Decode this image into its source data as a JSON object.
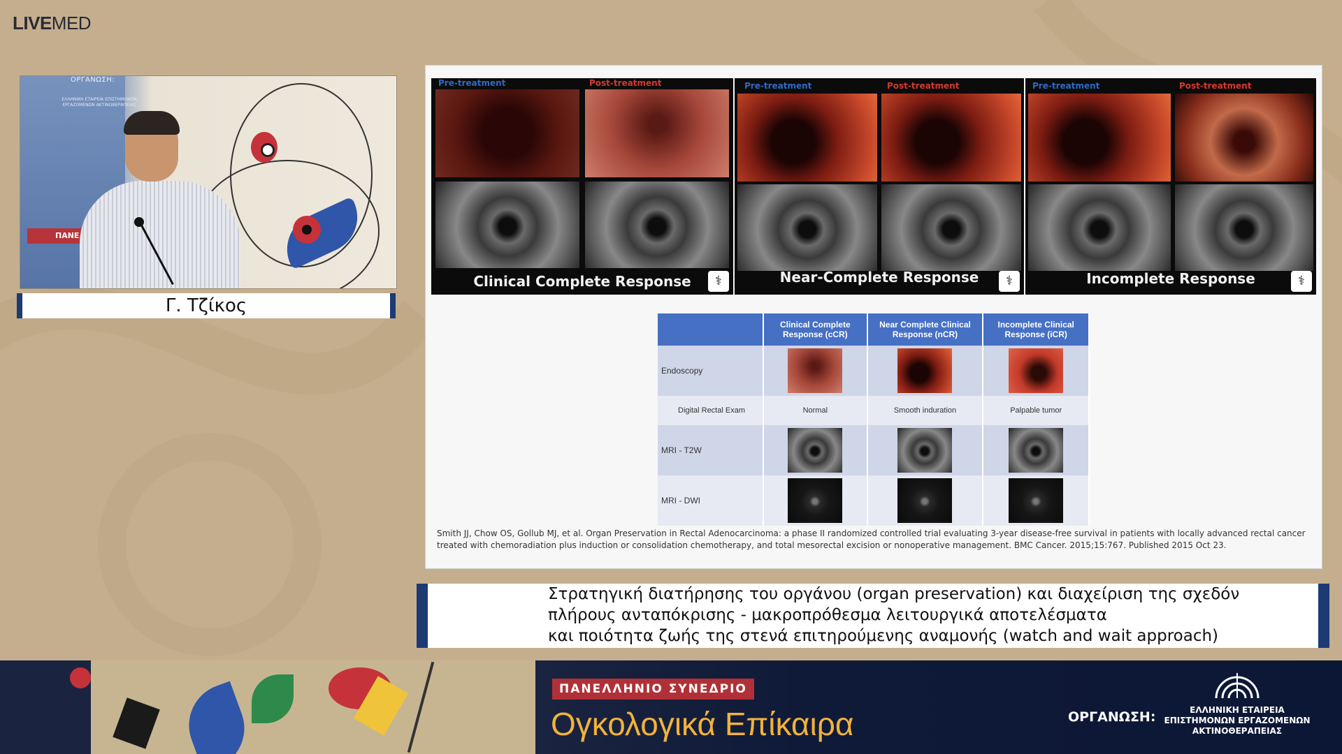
{
  "brand": {
    "logo_bold": "LIVE",
    "logo_rest": "MED"
  },
  "speaker": {
    "name": "Γ. Τζίκος",
    "backdrop_label": "ΟΡΓΑΝΩΣΗ:",
    "backdrop_small": "ΕΛΛΗΝΙΚΗ ΕΤΑΙΡΕΙΑ ΕΠΙΣΤΗΜΟΝΩΝ ΕΡΓΑΖΟΜΕΝΩΝ ΑΚΤΙΝΟΘΕΡΑΠΕΙΑΣ",
    "backdrop_red": "ΠΑΝΕ"
  },
  "slide": {
    "panels": [
      {
        "pre": "Pre-treatment",
        "post": "Post-treatment",
        "title": "Clinical Complete Response"
      },
      {
        "pre": "Pre-treatment",
        "post": "Post-treatment",
        "title": "Near-Complete Response"
      },
      {
        "pre": "Pre-treatment",
        "post": "Post-treatment",
        "title": "Incomplete Response"
      }
    ],
    "table": {
      "headers": [
        "Clinical Complete Response (cCR)",
        "Near Complete Clinical Response (nCR)",
        "Incomplete Clinical Response (iCR)"
      ],
      "rows": [
        {
          "label": "Endoscopy"
        },
        {
          "label": "Digital Rectal Exam",
          "values": [
            "Normal",
            "Smooth induration",
            "Palpable tumor"
          ]
        },
        {
          "label": "MRI - T2W"
        },
        {
          "label": "MRI - DWI"
        }
      ]
    },
    "citation": "Smith JJ, Chow OS, Gollub MJ, et al. Organ Preservation in Rectal Adenocarcinoma: a phase II randomized controlled trial evaluating 3-year disease-free survival in patients with locally advanced rectal cancer treated with chemoradiation plus induction or consolidation chemotherapy, and total mesorectal excision or nonoperative management. BMC Cancer. 2015;15:767. Published 2015 Oct 23."
  },
  "lower_third": {
    "line1": "Στρατηγική διατήρησης του οργάνου (organ preservation) και διαχείριση της σχεδόν",
    "line2": "πλήρους ανταπόκρισης - μακροπρόθεσμα λειτουργικά αποτελέσματα",
    "line3": "και ποιότητα ζωής της στενά επιτηρούμενης αναμονής (watch and wait approach)"
  },
  "footer": {
    "badge": "ΠΑΝΕΛΛΗΝΙΟ ΣΥΝΕΔΡΙΟ",
    "conference": "Ογκολογικά Επίκαιρα",
    "org_label": "ΟΡΓΑΝΩΣΗ:",
    "org_name_1": "ΕΛΛΗΝΙΚΗ ΕΤΑΙΡΕΙΑ",
    "org_name_2": "ΕΠΙΣΤΗΜΟΝΩΝ ΕΡΓΑΖΟΜΕΝΩΝ",
    "org_name_3": "ΑΚΤΙΝΟΘΕΡΑΠΕΙΑΣ"
  },
  "colors": {
    "navy": "#1d3a73",
    "accent_red": "#b13037",
    "gold": "#f2b23a",
    "table_header": "#4670c4"
  }
}
